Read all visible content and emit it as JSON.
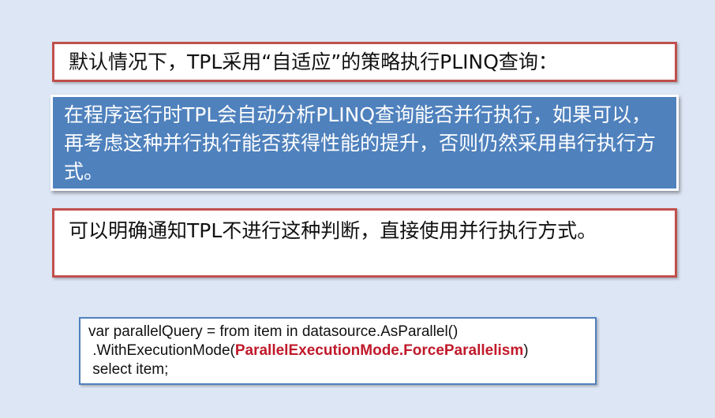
{
  "boxes": {
    "default_strategy": "默认情况下，TPL采用“自适应”的策略执行PLINQ查询：",
    "runtime_analysis": "在程序运行时TPL会自动分析PLINQ查询能否并行执行，如果可以，再考虑这种并行执行能否获得性能的提升，否则仍然采用串行执行方式。",
    "force_parallel": "可以明确通知TPL不进行这种判断，直接使用并行执行方式。"
  },
  "code": {
    "line1": "var parallelQuery = from item in datasource.AsParallel()",
    "line2_prefix": " .WithExecutionMode(",
    "line2_highlight": "ParallelExecutionMode.ForceParallelism",
    "line2_suffix": ")",
    "line3": " select item;"
  },
  "colors": {
    "background": "#dde6f4",
    "red_border": "#c0504d",
    "blue_box": "#4f81bd",
    "code_highlight": "#c0192a"
  }
}
